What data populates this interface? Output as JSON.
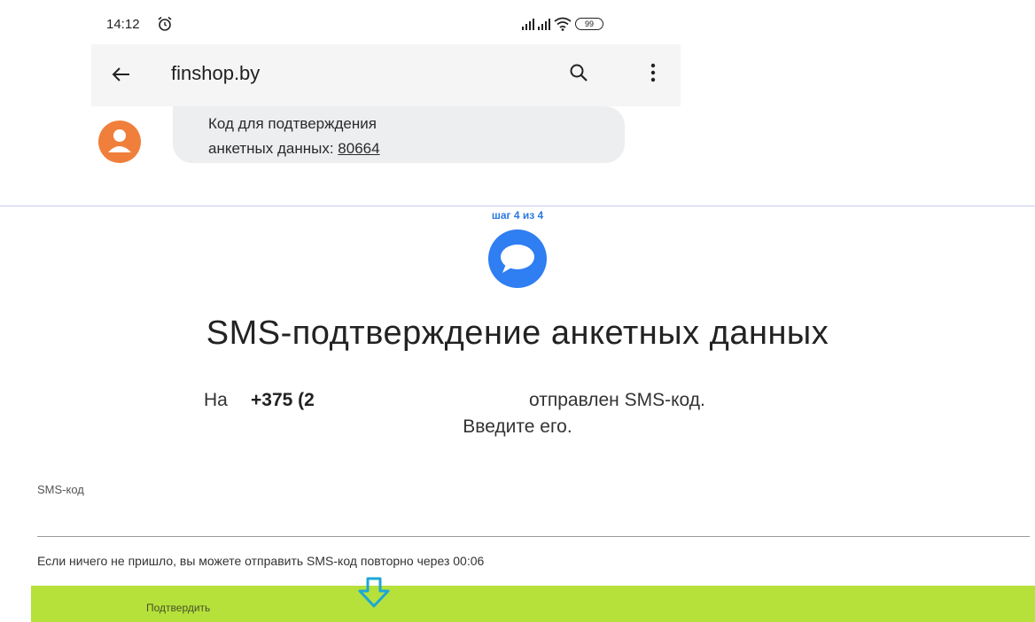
{
  "phone": {
    "status_time": "14:12",
    "battery": "99",
    "thread_title": "finshop.by",
    "message_line1": "Код для подтверждения",
    "message_line2_prefix": "анкетных данных: ",
    "message_code": "80664"
  },
  "form": {
    "step": "шаг 4 из 4",
    "title": "SMS-подтверждение анкетных данных",
    "sent_prefix": "На",
    "sent_phone": "+375 (2",
    "sent_suffix": "отправлен SMS-код.",
    "enter_prompt": "Введите его.",
    "sms_label": "SMS-код",
    "sms_value": "",
    "resend_text": "Если ничего не пришло, вы можете отправить SMS-код повторно через 00:06",
    "confirm_label": "Подтвердить"
  },
  "colors": {
    "accent_blue": "#2b79e0",
    "confirm_green": "#b6e13b",
    "avatar_orange": "#f07f3c"
  },
  "icons": [
    "alarm-icon",
    "signal-icon",
    "wifi-icon",
    "battery-icon",
    "back-arrow-icon",
    "search-icon",
    "more-vert-icon",
    "person-icon",
    "chat-bubble-icon",
    "arrow-down-icon"
  ]
}
